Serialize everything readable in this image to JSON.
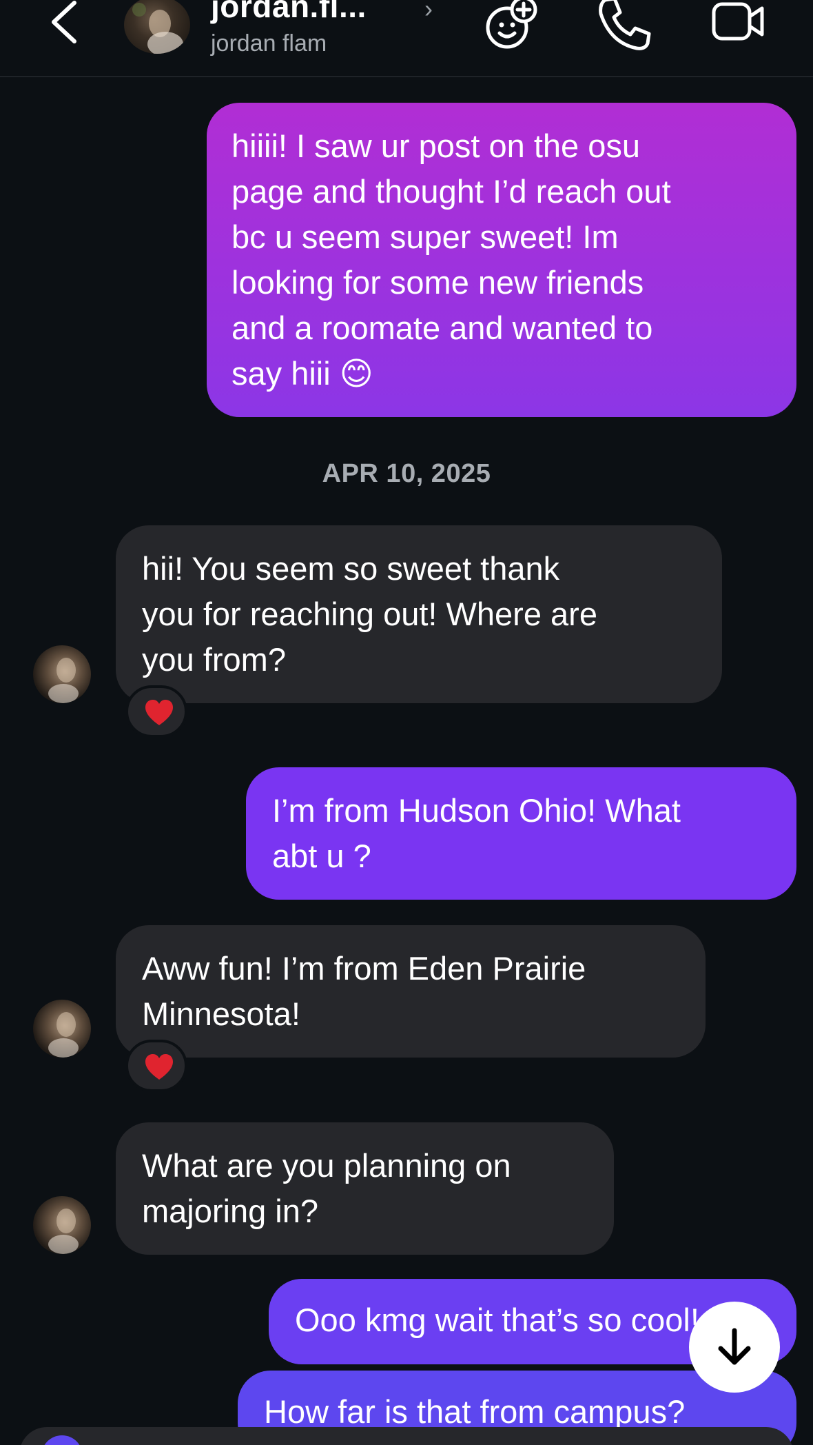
{
  "header": {
    "username": "jordan.fl...",
    "display_name": "jordan flam",
    "chevron": "›"
  },
  "icons": {
    "back": "chevron-left-icon",
    "add_sticker": "sticker-add-icon",
    "call": "phone-icon",
    "video": "video-camera-icon",
    "reaction": "red-heart-icon",
    "scroll_down": "arrow-down-icon"
  },
  "colors": {
    "background": "#0c1014",
    "incoming_bubble": "#26272b",
    "outgoing_gradient_top": "#b12ed4",
    "outgoing_purple": "#7a35f2",
    "outgoing_blue": "#5d47ef",
    "heart": "#e0242f"
  },
  "date_separator": "APR 10, 2025",
  "messages": [
    {
      "from": "me",
      "text": "hiiii! I saw ur post on the osu\npage and thought I’d reach out\nbc u seem super sweet! Im\nlooking for some new friends\nand a roomate and wanted to\nsay hiii 😊"
    },
    {
      "from": "them",
      "text": "hii! You seem so sweet thank\nyou for reaching out! Where are\nyou from?",
      "reaction": "❤️"
    },
    {
      "from": "me",
      "text": "I’m from Hudson Ohio! What\nabt u ?"
    },
    {
      "from": "them",
      "text": "Aww fun! I’m from Eden Prairie\nMinnesota!",
      "reaction": "❤️"
    },
    {
      "from": "them",
      "text": "What are you planning on\nmajoring in?"
    },
    {
      "from": "me",
      "text": "Ooo kmg wait that’s so cool!"
    },
    {
      "from": "me",
      "text": "How far is that from campus?"
    }
  ]
}
